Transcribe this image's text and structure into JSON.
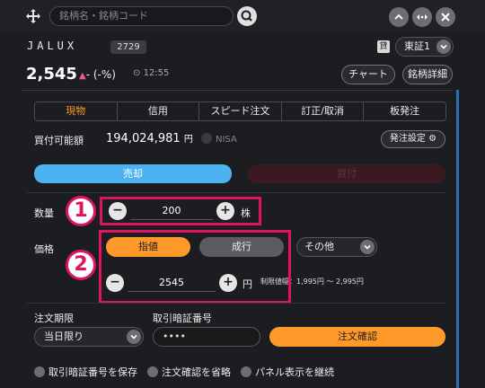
{
  "header": {
    "search_placeholder": "銘柄名・銘柄コード",
    "icons": [
      "move-icon",
      "search-icon",
      "chevron-up-icon",
      "swap-icon",
      "close-icon"
    ]
  },
  "stock": {
    "name": "JALUX",
    "code": "2729",
    "kashi_badge": "貸",
    "market": "東証1",
    "price": "2,545",
    "change": "- (-%)",
    "time": "12:55",
    "chart_label": "チャート",
    "detail_label": "銘柄詳細"
  },
  "tabs": [
    {
      "label": "現物",
      "active": true
    },
    {
      "label": "信用",
      "active": false
    },
    {
      "label": "スピード注文",
      "active": false
    },
    {
      "label": "訂正/取消",
      "active": false
    },
    {
      "label": "板発注",
      "active": false
    }
  ],
  "account": {
    "buyable_label": "買付可能額",
    "buyable_value": "194,024,981",
    "buyable_unit": "円",
    "nisa_label": "NISA",
    "order_setting_label": "発注設定"
  },
  "trade": {
    "sell_label": "売却",
    "buy_label": "買付"
  },
  "quantity": {
    "label": "数量",
    "value": "200",
    "unit": "株",
    "badge": "1"
  },
  "price_input": {
    "label": "価格",
    "limit_label": "指値",
    "market_label": "成行",
    "other_label": "その他",
    "value": "2545",
    "unit": "円",
    "range_label": "制限値幅：1,995円 〜 2,995円",
    "badge": "2"
  },
  "order": {
    "period_label": "注文期限",
    "period_value": "当日限り",
    "pin_label": "取引暗証番号",
    "pin_value": "••••",
    "confirm_label": "注文確認"
  },
  "options": {
    "save_pin": "取引暗証番号を保存",
    "skip_confirm": "注文確認を省略",
    "keep_panel": "パネル表示を継続"
  },
  "colors": {
    "accent": "#ff9a2a",
    "sell": "#4db3f0",
    "highlight": "#e0145e",
    "background": "#1c1d20"
  }
}
